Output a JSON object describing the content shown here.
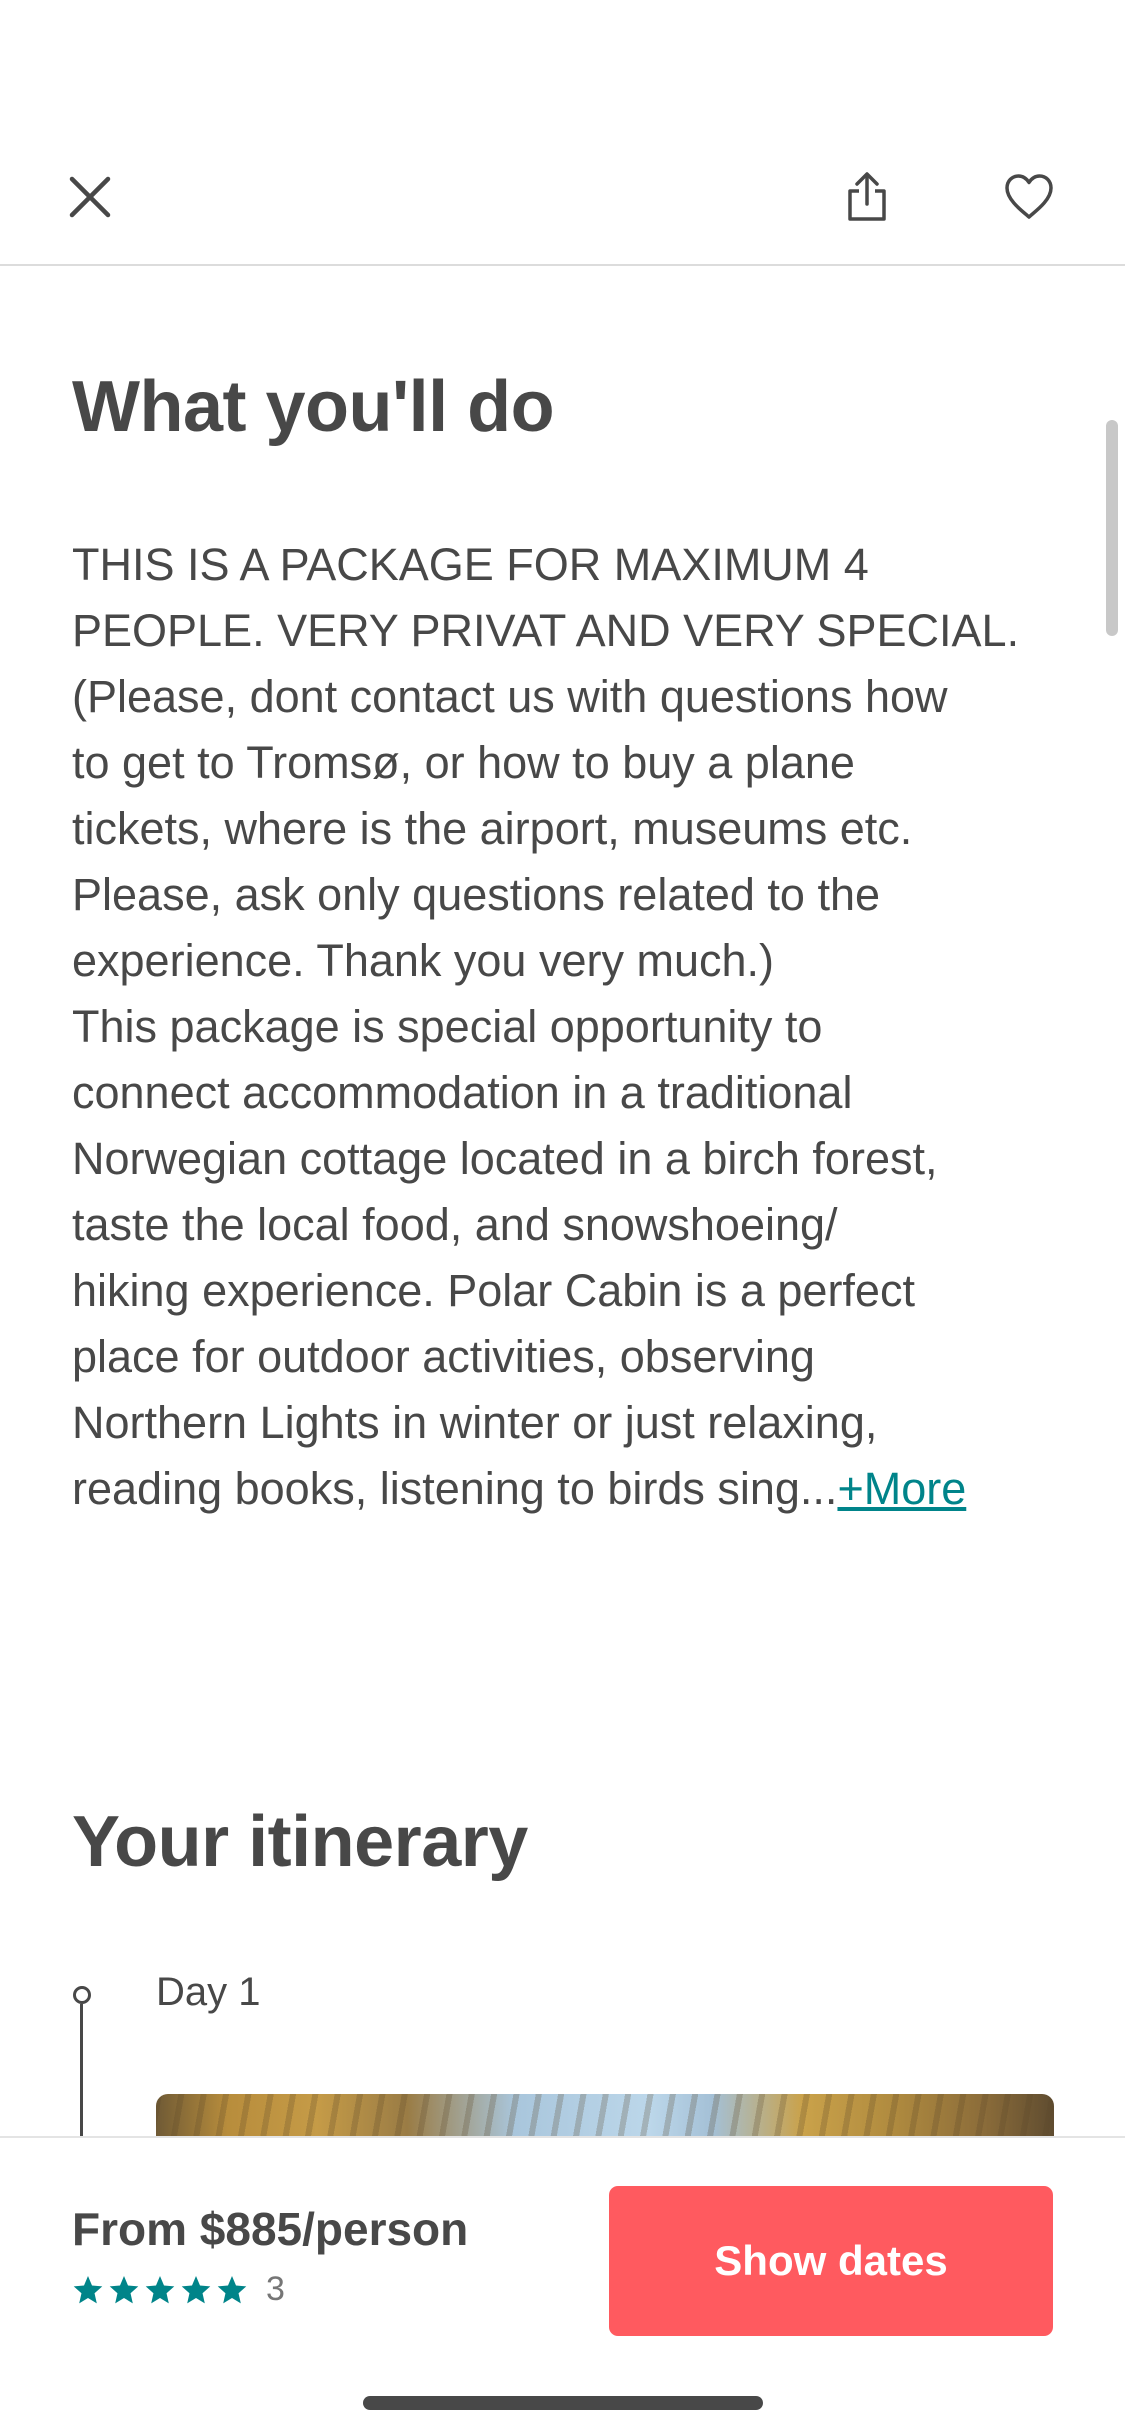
{
  "header": {
    "close_icon": "close-icon",
    "share_icon": "share-icon",
    "favorite_icon": "heart-icon"
  },
  "what_youll_do": {
    "title": "What you'll do",
    "description_lines": [
      "THIS IS A PACKAGE FOR MAXIMUM 4",
      "PEOPLE. VERY PRIVAT AND VERY SPECIAL.",
      "(Please, dont contact us with questions how",
      "to get to Tromsø, or how to buy a plane",
      "tickets, where is the airport, museums etc.",
      "Please, ask only questions related to the",
      "experience. Thank you very much.)",
      "This package is special opportunity to",
      "connect accommodation in a traditional",
      "Norwegian cottage located in a birch forest,",
      "taste the local food, and snowshoeing/",
      "hiking experience. Polar Cabin is a perfect",
      "place for outdoor activities, observing",
      "Northern Lights in winter or just relaxing,",
      "reading books, listening to birds sing..."
    ],
    "more_label": "+More"
  },
  "itinerary": {
    "title": "Your itinerary",
    "days": [
      {
        "label": "Day 1"
      }
    ]
  },
  "booking": {
    "price": "From $885/person",
    "stars": 5,
    "review_count": "3",
    "cta_label": "Show dates"
  },
  "colors": {
    "text": "#484848",
    "link": "#00848a",
    "star": "#008489",
    "cta_background": "#ff5a5f"
  }
}
